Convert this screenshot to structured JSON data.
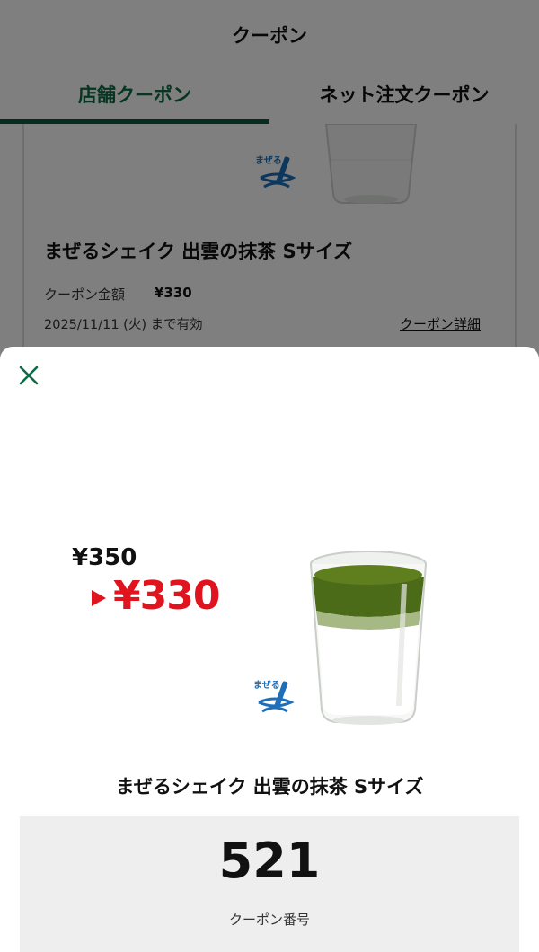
{
  "header": {
    "title": "クーポン"
  },
  "tabs": [
    {
      "label": "店舗クーポン",
      "active": true
    },
    {
      "label": "ネット注文クーポン",
      "active": false
    }
  ],
  "coupon_card": {
    "logo_text": "まぜる",
    "title": "まぜるシェイク 出雲の抹茶 Sサイズ",
    "amount_label": "クーポン金額",
    "amount": "¥330",
    "expiry": "2025/11/11 (火) まで有効",
    "detail_link": "クーポン詳細"
  },
  "sheet": {
    "close_icon": "close-icon",
    "old_price": "¥350",
    "new_price": "¥330",
    "logo_text": "まぜる",
    "product_name": "まぜるシェイク 出雲の抹茶 Sサイズ",
    "coupon_number": "521",
    "coupon_number_label": "クーポン番号"
  },
  "colors": {
    "accent_green": "#0d6b45",
    "price_red": "#e0141e",
    "logo_blue": "#1e6fb8"
  }
}
